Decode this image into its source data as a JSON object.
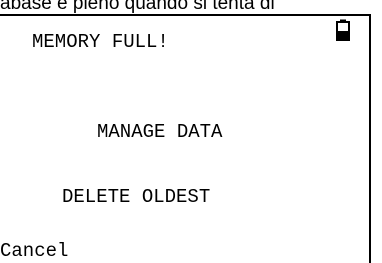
{
  "caption": {
    "text": "abase è pieno quando si tenta di"
  },
  "screen": {
    "title": "MEMORY FULL!",
    "battery_icon": "battery-low-icon",
    "options": [
      {
        "label": "MANAGE DATA"
      },
      {
        "label": "DELETE OLDEST"
      }
    ],
    "softkey_left": "Cancel"
  }
}
